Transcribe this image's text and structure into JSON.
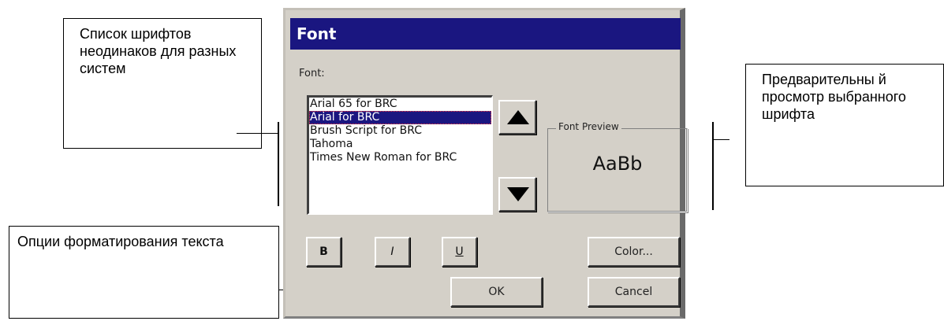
{
  "dialog": {
    "title": "Font",
    "font_label": "Font:",
    "font_list": [
      "Arial 65 for BRC",
      "Arial for BRC",
      "Brush Script for BRC",
      "Tahoma",
      "Times New Roman for BRC"
    ],
    "selected_index": 1,
    "preview_label": "Font Preview",
    "preview_sample": "AaBb",
    "bold_label": "B",
    "italic_label": "I",
    "underline_label": "U",
    "color_label": "Color...",
    "ok_label": "OK",
    "cancel_label": "Cancel"
  },
  "callouts": {
    "font_list_note": "Список шрифтов неодинаков для разных систем",
    "preview_note": "Предварительны й просмотр выбранного шрифта",
    "formatting_note": "Опции форматирования текста"
  },
  "colors": {
    "titlebar": "#1a1680",
    "dialog_face": "#d4d0c8",
    "selection": "#1a1680"
  }
}
